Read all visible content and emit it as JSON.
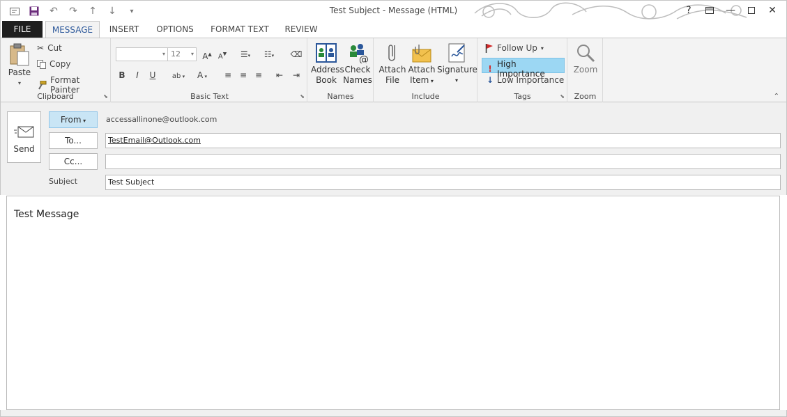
{
  "window": {
    "title": "Test Subject - Message (HTML)"
  },
  "tabs": [
    {
      "label": "FILE"
    },
    {
      "label": "MESSAGE"
    },
    {
      "label": "INSERT"
    },
    {
      "label": "OPTIONS"
    },
    {
      "label": "FORMAT TEXT"
    },
    {
      "label": "REVIEW"
    }
  ],
  "ribbon": {
    "clipboard": {
      "label": "Clipboard",
      "paste": "Paste",
      "cut": "Cut",
      "copy": "Copy",
      "format_painter": "Format Painter"
    },
    "basic_text": {
      "label": "Basic Text",
      "font_size": "12"
    },
    "names": {
      "label": "Names",
      "address_book": [
        "Address",
        "Book"
      ],
      "check_names": [
        "Check",
        "Names"
      ]
    },
    "include": {
      "label": "Include",
      "attach_file": [
        "Attach",
        "File"
      ],
      "attach_item": [
        "Attach",
        "Item"
      ],
      "signature": "Signature"
    },
    "tags": {
      "label": "Tags",
      "follow_up": "Follow Up",
      "high_importance": "High Importance",
      "low_importance": "Low Importance"
    },
    "zoom": {
      "label": "Zoom",
      "zoom": "Zoom"
    }
  },
  "header": {
    "send": "Send",
    "from_label": "From",
    "from_value": "accessallinone@outlook.com",
    "to_label": "To...",
    "to_value": "TestEmail@Outlook.com",
    "cc_label": "Cc...",
    "cc_value": "",
    "subject_label": "Subject",
    "subject_value": "Test Subject"
  },
  "body": {
    "message": "Test Message"
  },
  "colors": {
    "accent": "#2b579a",
    "high_importance_bg": "#9cd7f3",
    "from_button_bg": "#c9e5f5"
  }
}
